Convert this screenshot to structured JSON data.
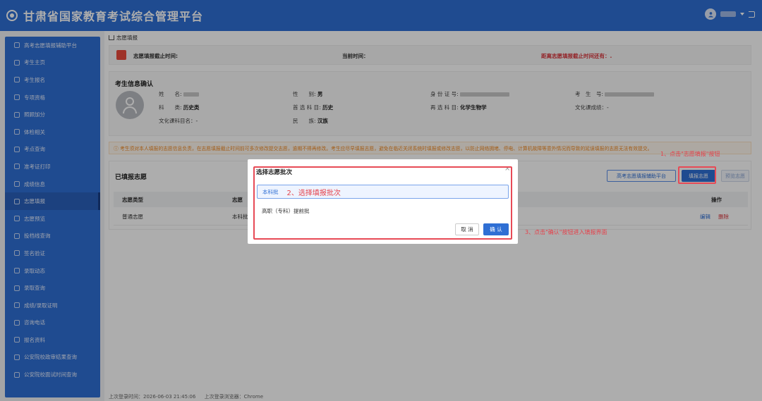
{
  "header": {
    "title": "甘肃省国家教育考试综合管理平台"
  },
  "sidebar": {
    "items": [
      {
        "label": "高考志愿填报辅助平台",
        "icon": "grid-icon"
      },
      {
        "label": "考生主页",
        "icon": "user-icon"
      },
      {
        "label": "考生报名",
        "icon": "form-icon"
      },
      {
        "label": "专项资格",
        "icon": "check-icon"
      },
      {
        "label": "照顾加分",
        "icon": "plus-icon"
      },
      {
        "label": "体检相关",
        "icon": "eye-icon"
      },
      {
        "label": "考点查询",
        "icon": "search-icon"
      },
      {
        "label": "准考证打印",
        "icon": "print-icon"
      },
      {
        "label": "成绩信息",
        "icon": "chart-icon"
      },
      {
        "label": "志愿填报",
        "icon": "form-icon"
      },
      {
        "label": "志愿预览",
        "icon": "doc-icon"
      },
      {
        "label": "投档线查询",
        "icon": "list-icon"
      },
      {
        "label": "签名验证",
        "icon": "sign-icon"
      },
      {
        "label": "录取动态",
        "icon": "bell-icon"
      },
      {
        "label": "录取查询",
        "icon": "doc-icon"
      },
      {
        "label": "成绩/录取证明",
        "icon": "cert-icon"
      },
      {
        "label": "咨询电话",
        "icon": "phone-icon"
      },
      {
        "label": "报名资料",
        "icon": "folder-icon"
      },
      {
        "label": "公安院校政审结果查询",
        "icon": "shield-icon"
      },
      {
        "label": "公安院校面试时间查询",
        "icon": "clock-icon"
      }
    ],
    "active_index": 9
  },
  "breadcrumb": {
    "current": "志愿填报"
  },
  "info_bar": {
    "deadline_label": "志愿填报截止时间:",
    "now_label": "当前时间：",
    "remaining_label": "距离志愿填报截止时间还有：."
  },
  "candidate": {
    "section_title": "考生信息确认",
    "name_label": "姓　　名:",
    "gender_label": "性　　别:",
    "gender_value": "男",
    "id_label": "身 份 证 号:",
    "exam_no_label": "考　生　号:",
    "subject_label": "科　　类:",
    "subject_value": "历史类",
    "first_choice_label": "首 选 科 目:",
    "first_choice_value": "历史",
    "second_choice_label": "再 选 科 目:",
    "second_choice_value": "化学生物学",
    "culture_score_label": "文化课成绩：-",
    "culture_subjects_label": "文化课科目名：-",
    "ethnicity_label": "民　　族:",
    "ethnicity_value": "汉族"
  },
  "notice": "ⓘ 考生须对本人填报的志愿信息负责，在志愿填报截止时间前可多次修改提交志愿，逾期不得再修改。考生应尽早填报志愿，避免在临近关闭系统时填报或修改志愿，以防止网络拥堵、停电、计算机故障等意外情况而导致的延误填报的志愿无法有效提交。",
  "filled": {
    "section_title": "已填报志愿",
    "assist_button": "高考志愿填报辅助平台",
    "fill_button": "填报志愿",
    "preview_button": "预览志愿",
    "headers": {
      "type": "志愿类型",
      "col2": "志愿",
      "ops": "操作"
    },
    "rows": [
      {
        "type": "普通志愿",
        "col2": "本科批",
        "edit": "编辑",
        "delete": "删除"
      }
    ]
  },
  "footer": {
    "last_login_time": "上次登录时间：2026-06-03 21:45:06",
    "last_login_browser": "上次登录浏览器：Chrome"
  },
  "modal": {
    "title": "选择志愿批次",
    "close": "×",
    "options": [
      "本科批",
      "高职（专科）提前批"
    ],
    "selected_index": 0,
    "step2_note": "2、选择填报批次",
    "cancel": "取 消",
    "confirm": "确 认"
  },
  "annotations": {
    "step1": "1、点击\"志愿填报\"按钮",
    "step3": "3、点击\"确认\"按钮进入填报界面"
  },
  "colors": {
    "primary": "#2f6fd4",
    "annotation_red": "#e5414b"
  }
}
